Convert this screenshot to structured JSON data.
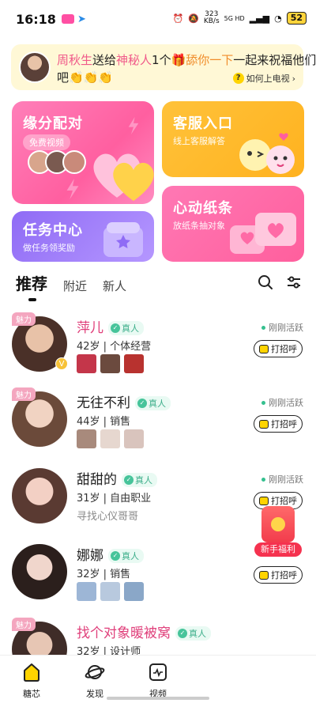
{
  "status_bar": {
    "time": "16:18",
    "net_speed": "323\nKB/s",
    "network": "5G HD",
    "battery": "52"
  },
  "banner": {
    "user": "周秋生",
    "text1": "送给",
    "target": "神秘人",
    "text2": "1个",
    "gift": "舔你一下",
    "text3": "一起来祝福他们",
    "line2": "吧👏👏👏",
    "help": "如何上电视"
  },
  "cards": {
    "match": {
      "title": "缘分配对",
      "pill": "免费视频"
    },
    "service": {
      "title": "客服入口",
      "sub": "线上客服解答"
    },
    "task": {
      "title": "任务中心",
      "sub": "做任务领奖励"
    },
    "note": {
      "title": "心动纸条",
      "sub": "放纸条抽对象"
    }
  },
  "tabs": [
    "推荐",
    "附近",
    "新人"
  ],
  "list": [
    {
      "name": "萍儿",
      "badge": "魅力",
      "verified": "真人",
      "info": "42岁 | 个体经营",
      "online": "刚刚活跃",
      "greet": "打招呼"
    },
    {
      "name": "无往不利",
      "badge": "魅力",
      "verified": "真人",
      "info": "44岁 | 销售",
      "online": "刚刚活跃",
      "greet": "打招呼"
    },
    {
      "name": "甜甜的",
      "verified": "真人",
      "info": "31岁 | 自由职业",
      "motto": "寻找心仪哥哥",
      "online": "刚刚活跃",
      "greet": "打招呼"
    },
    {
      "name": "娜娜",
      "verified": "真人",
      "info": "32岁 | 销售",
      "greet": "打招呼"
    },
    {
      "name": "找个对象暖被窝",
      "badge": "魅力",
      "verified": "真人",
      "info": "32岁 | 设计师"
    }
  ],
  "float_promo": {
    "label": "新手福利"
  },
  "bottom_nav": [
    {
      "label": "糖芯",
      "icon": "home-icon"
    },
    {
      "label": "发现",
      "icon": "planet-icon"
    },
    {
      "label": "视频",
      "icon": "video-icon"
    }
  ],
  "colors": {
    "pink": "#ff5fa0",
    "yellow": "#ffc23a",
    "purple": "#8f6bf5",
    "accent_yellow": "#ffd400"
  }
}
